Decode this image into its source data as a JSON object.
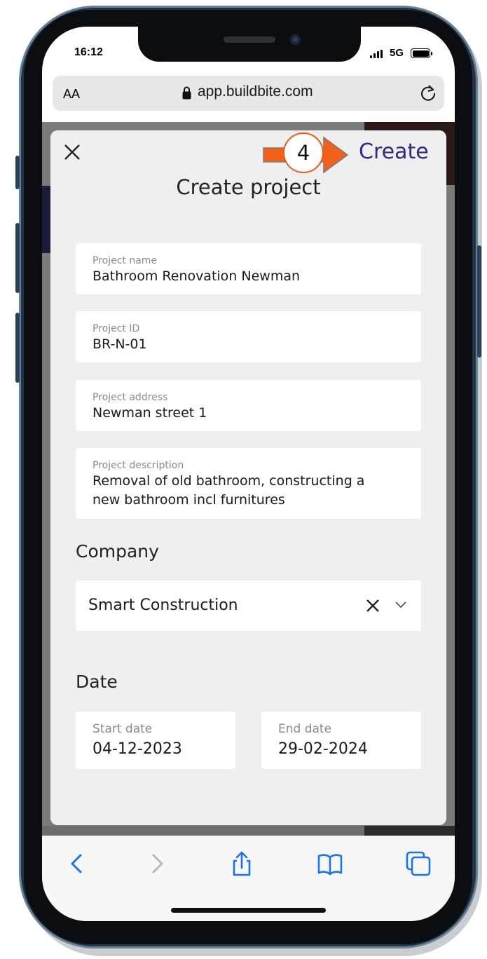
{
  "status_bar": {
    "time": "16:12",
    "network": "5G"
  },
  "browser": {
    "text_size_label": "AA",
    "url": "app.buildbite.com"
  },
  "modal": {
    "title": "Create project",
    "create_label": "Create",
    "step_number": "4",
    "fields": [
      {
        "label": "Project name",
        "value": "Bathroom Renovation Newman"
      },
      {
        "label": "Project ID",
        "value": "BR-N-01"
      },
      {
        "label": "Project address",
        "value": "Newman street 1"
      },
      {
        "label": "Project description",
        "value_line1": "Removal of old bathroom, constructing a",
        "value_line2": "new bathroom incl furnitures"
      }
    ],
    "company": {
      "section_label": "Company",
      "selected": "Smart Construction"
    },
    "date": {
      "section_label": "Date",
      "start": {
        "label": "Start date",
        "value": "04-12-2023"
      },
      "end": {
        "label": "End date",
        "value": "29-02-2024"
      }
    }
  },
  "colors": {
    "accent": "#2f2a82",
    "annotation": "#e85a16",
    "toolbar_icon": "#1a73e8"
  },
  "icons": [
    "close-icon",
    "lock-icon",
    "reload-icon",
    "back-icon",
    "forward-icon",
    "share-icon",
    "bookmarks-icon",
    "tabs-icon",
    "clear-icon",
    "chevron-down-icon"
  ]
}
